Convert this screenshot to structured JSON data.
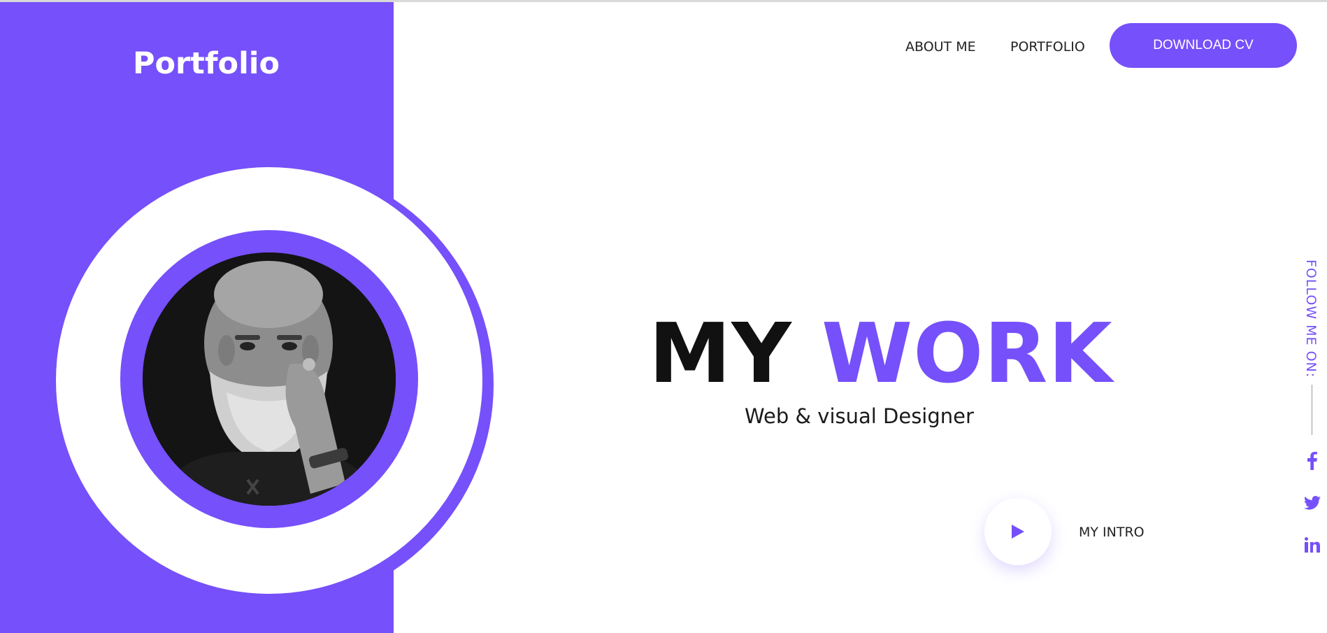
{
  "brand": {
    "logo_text": "Portfolio"
  },
  "nav": {
    "items": [
      {
        "label": "ABOUT ME"
      },
      {
        "label": "PORTFOLIO"
      }
    ],
    "cta_label": "DOWNLOAD CV"
  },
  "hero": {
    "title_part1": "MY",
    "title_part2": "WORK",
    "subtitle": "Web & visual Designer",
    "intro_label": "MY INTRO"
  },
  "social": {
    "follow_label": "FOLLOW ME ON:",
    "icons": [
      "facebook-icon",
      "twitter-icon",
      "linkedin-icon"
    ]
  },
  "colors": {
    "accent": "#7650fa",
    "text": "#222222",
    "background": "#ffffff"
  }
}
